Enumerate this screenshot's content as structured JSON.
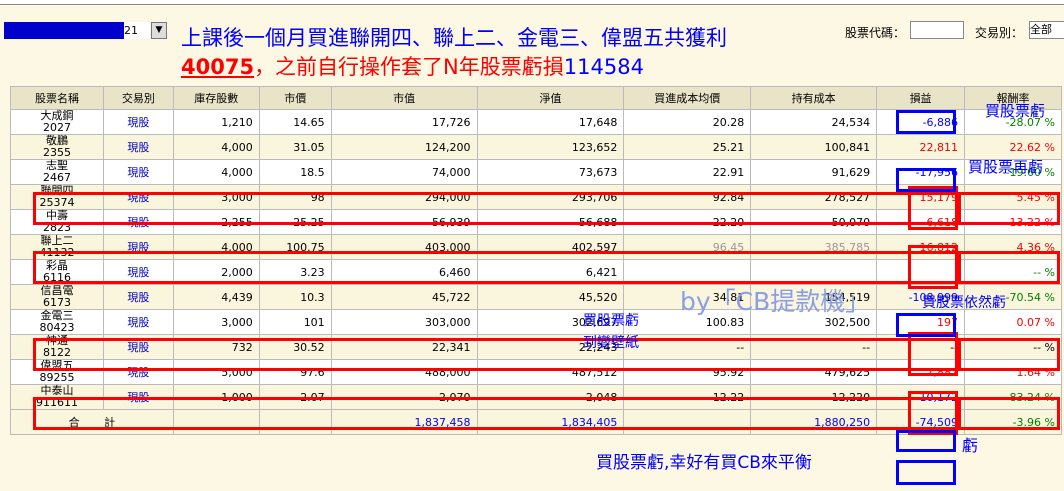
{
  "top": {
    "select_value": "21",
    "headline_line1": "上課後一個月買進聯開四、聯上二、金電三、偉盟五共獲利",
    "headline_profit": "40075",
    "headline_mid": "，之前自行操作套了N年股票虧損",
    "headline_loss": "114584",
    "code_label": "股票代碼：",
    "code_value": "",
    "type_label": "交易別：",
    "type_value": "全部"
  },
  "columns": [
    "股票名稱",
    "交易別",
    "庫存股數",
    "市價",
    "市值",
    "淨值",
    "買進成本均價",
    "持有成本",
    "損益",
    "報酬率"
  ],
  "rows": [
    {
      "name": "大成鋼",
      "code": "2027",
      "type": "現股",
      "shares": "1,210",
      "price": "14.65",
      "mv": "17,726",
      "nv": "17,648",
      "avg": "20.28",
      "cost": "24,534",
      "pl": "-6,886",
      "roi": "-28.07 %",
      "sign": "neg"
    },
    {
      "name": "敬鵬",
      "code": "2355",
      "type": "現股",
      "shares": "4,000",
      "price": "31.05",
      "mv": "124,200",
      "nv": "123,652",
      "avg": "25.21",
      "cost": "100,841",
      "pl": "22,811",
      "roi": "22.62 %",
      "sign": "pos"
    },
    {
      "name": "志聖",
      "code": "2467",
      "type": "現股",
      "shares": "4,000",
      "price": "18.5",
      "mv": "74,000",
      "nv": "73,673",
      "avg": "22.91",
      "cost": "91,629",
      "pl": "-17,956",
      "roi": "-19.60 %",
      "sign": "neg"
    },
    {
      "name": "聯開四",
      "code": "25374",
      "type": "現股",
      "shares": "3,000",
      "price": "98",
      "mv": "294,000",
      "nv": "293,706",
      "avg": "92.84",
      "cost": "278,527",
      "pl": "15,179",
      "roi": "5.45 %",
      "sign": "pos"
    },
    {
      "name": "中壽",
      "code": "2823",
      "type": "現股",
      "shares": "2,255",
      "price": "25.25",
      "mv": "56,939",
      "nv": "56,688",
      "avg": "22.20",
      "cost": "50,070",
      "pl": "6,618",
      "roi": "13.22 %",
      "sign": "pos"
    },
    {
      "name": "聯上二",
      "code": "41132",
      "type": "現股",
      "shares": "4,000",
      "price": "100.75",
      "mv": "403,000",
      "nv": "402,597",
      "avg": "96.45",
      "cost": "385,785",
      "pl": "16,812",
      "roi": "4.36 %",
      "sign": "pos"
    },
    {
      "name": "彩晶",
      "code": "6116",
      "type": "現股",
      "shares": "2,000",
      "price": "3.23",
      "mv": "6,460",
      "nv": "6,421",
      "avg": "",
      "cost": "",
      "pl": "",
      "roi": "-- %",
      "sign": "neg"
    },
    {
      "name": "信昌電",
      "code": "6173",
      "type": "現股",
      "shares": "4,439",
      "price": "10.3",
      "mv": "45,722",
      "nv": "45,520",
      "avg": "34.81",
      "cost": "154,519",
      "pl": "-108,999",
      "roi": "-70.54 %",
      "sign": "neg"
    },
    {
      "name": "金電三",
      "code": "80423",
      "type": "現股",
      "shares": "3,000",
      "price": "101",
      "mv": "303,000",
      "nv": "302,697",
      "avg": "100.83",
      "cost": "302,500",
      "pl": "197",
      "roi": "0.07 %",
      "sign": "pos"
    },
    {
      "name": "神通",
      "code": "8122",
      "type": "現股",
      "shares": "732",
      "price": "30.52",
      "mv": "22,341",
      "nv": "22,243",
      "avg": "--",
      "cost": "--",
      "pl": "--",
      "roi": "-- %",
      "sign": "none"
    },
    {
      "name": "偉盟五",
      "code": "89255",
      "type": "現股",
      "shares": "5,000",
      "price": "97.6",
      "mv": "488,000",
      "nv": "487,512",
      "avg": "95.92",
      "cost": "479,625",
      "pl": "7,887",
      "roi": "1.64 %",
      "sign": "pos"
    },
    {
      "name": "中泰山",
      "code": "911611",
      "type": "現股",
      "shares": "1,000",
      "price": "2.07",
      "mv": "2,070",
      "nv": "2,048",
      "avg": "12.22",
      "cost": "12,220",
      "pl": "-10,172",
      "roi": "-83.24 %",
      "sign": "neg"
    }
  ],
  "total": {
    "label1": "合",
    "label2": "計",
    "mv": "1,837,458",
    "nv": "1,834,405",
    "cost": "1,880,250",
    "pl": "-74,509",
    "roi": "-3.96 %"
  },
  "notes": {
    "n1": "買股票虧",
    "n2": "買股票再虧",
    "n3": "買股票虧",
    "n4": "到變壁紙",
    "n5": "買股票依然虧",
    "n6": "虧",
    "n7": "買股票虧,幸好有買CB來平衡",
    "watermark": "by「CB提款機」"
  }
}
